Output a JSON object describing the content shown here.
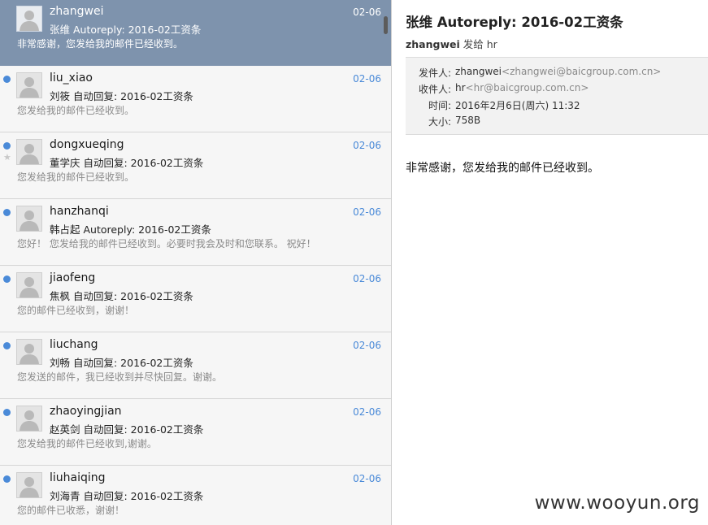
{
  "messages": [
    {
      "sender": "zhangwei",
      "date": "02-06",
      "subject": "张维 Autoreply: 2016-02工资条",
      "preview": "非常感谢，您发给我的邮件已经收到。",
      "selected": true,
      "unread": false,
      "starred": false
    },
    {
      "sender": "liu_xiao",
      "date": "02-06",
      "subject": "刘筱 自动回复: 2016-02工资条",
      "preview": "您发给我的邮件已经收到。",
      "selected": false,
      "unread": true,
      "starred": false
    },
    {
      "sender": "dongxueqing",
      "date": "02-06",
      "subject": "董学庆 自动回复: 2016-02工资条",
      "preview": "您发给我的邮件已经收到。",
      "selected": false,
      "unread": true,
      "starred": true
    },
    {
      "sender": "hanzhanqi",
      "date": "02-06",
      "subject": "韩占起 Autoreply: 2016-02工资条",
      "preview": "您好！ 您发给我的邮件已经收到。必要时我会及时和您联系。 祝好！",
      "selected": false,
      "unread": true,
      "starred": false
    },
    {
      "sender": "jiaofeng",
      "date": "02-06",
      "subject": "焦枫 自动回复: 2016-02工资条",
      "preview": "您的邮件已经收到，谢谢！",
      "selected": false,
      "unread": true,
      "starred": false
    },
    {
      "sender": "liuchang",
      "date": "02-06",
      "subject": "刘畅 自动回复: 2016-02工资条",
      "preview": "您发送的邮件，我已经收到并尽快回复。谢谢。",
      "selected": false,
      "unread": true,
      "starred": false
    },
    {
      "sender": "zhaoyingjian",
      "date": "02-06",
      "subject": "赵英剑 自动回复: 2016-02工资条",
      "preview": "您发给我的邮件已经收到,谢谢。",
      "selected": false,
      "unread": true,
      "starred": false
    },
    {
      "sender": "liuhaiqing",
      "date": "02-06",
      "subject": "刘海青 自动回复: 2016-02工资条",
      "preview": "您的邮件已收悉，谢谢！",
      "selected": false,
      "unread": true,
      "starred": false
    }
  ],
  "detail": {
    "title": "张维 Autoreply: 2016-02工资条",
    "from_name": "zhangwei",
    "sent_to_text": "发给 hr",
    "header": {
      "from_label": "发件人:",
      "from_name": "zhangwei",
      "from_addr": "<zhangwei@baicgroup.com.cn>",
      "to_label": "收件人:",
      "to_name": "hr",
      "to_addr": "<hr@baicgroup.com.cn>",
      "time_label": "时间:",
      "time_value": "2016年2月6日(周六) 11:32",
      "size_label": "大小:",
      "size_value": "758B"
    },
    "body": "非常感谢，您发给我的邮件已经收到。"
  },
  "watermark": "www.wooyun.org",
  "colors": {
    "selected_bg": "#7e93ad",
    "unread_dot": "#4a8ad8",
    "date": "#4a8ad8"
  }
}
